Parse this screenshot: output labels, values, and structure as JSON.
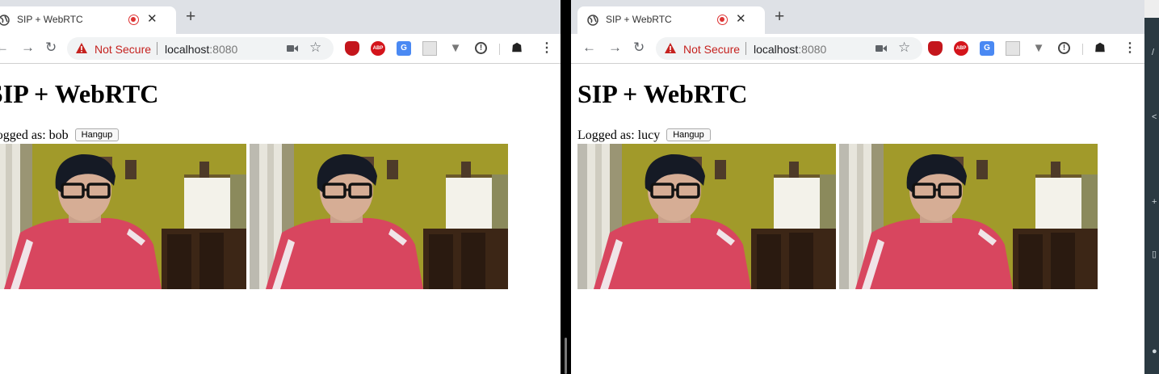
{
  "browser": {
    "tab_title": "SIP + WebRTC",
    "new_tab": "+",
    "close": "✕",
    "security_label": "Not Secure",
    "url_host": "localhost",
    "url_port": ":8080"
  },
  "extensions": {
    "abp": "ABP"
  },
  "page": {
    "heading": "SIP + WebRTC",
    "hangup_label": "Hangup"
  },
  "sessions": [
    {
      "logged_text": "Logged as: bob"
    },
    {
      "logged_text": "Logged as: lucy"
    }
  ],
  "colors": {
    "tabstrip": "#dee1e6",
    "warning_red": "#c5221f",
    "wall": "#9c9224",
    "shirt": "#d8465f"
  }
}
